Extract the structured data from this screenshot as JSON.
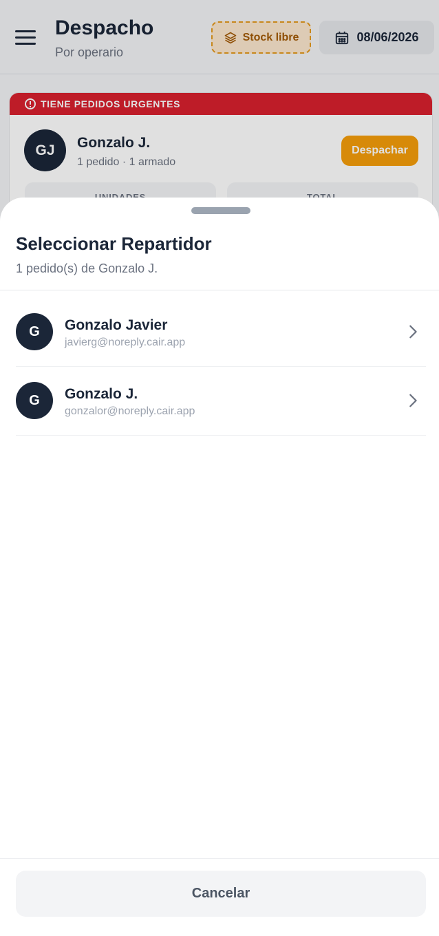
{
  "header": {
    "title": "Despacho",
    "subtitle": "Por operario",
    "stock_label": "Stock libre",
    "date": "08/06/2026"
  },
  "card": {
    "urgent_label": "TIENE PEDIDOS URGENTES",
    "avatar_initials": "GJ",
    "name": "Gonzalo J.",
    "meta": "1 pedido · 1 armado",
    "dispatch_label": "Despachar",
    "stats": [
      {
        "label": "UNIDADES"
      },
      {
        "label": "TOTAL"
      }
    ]
  },
  "sheet": {
    "title": "Seleccionar Repartidor",
    "subtitle": "1 pedido(s) de Gonzalo J.",
    "drivers": [
      {
        "initial": "G",
        "name": "Gonzalo Javier",
        "email": "javierg@noreply.cair.app"
      },
      {
        "initial": "G",
        "name": "Gonzalo J.",
        "email": "gonzalor@noreply.cair.app"
      }
    ],
    "cancel_label": "Cancelar"
  },
  "colors": {
    "navy": "#1b2638",
    "urgent_red": "#d9202e",
    "dispatch_orange": "#f59e0b",
    "stock_amber": "#fce8cf"
  }
}
